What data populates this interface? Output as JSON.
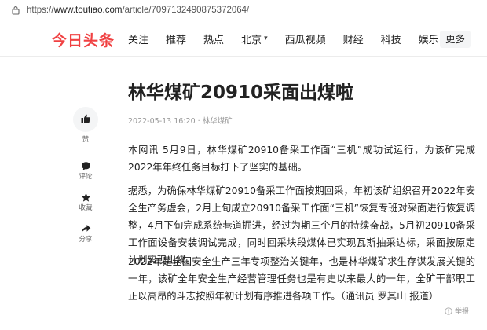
{
  "browser": {
    "url_prefix": "https://",
    "url_host": "www.toutiao.com",
    "url_path": "/article/7097132490875372064/"
  },
  "header": {
    "logo": "今日头条",
    "nav": [
      "关注",
      "推荐",
      "热点",
      "北京",
      "西瓜视频",
      "财经",
      "科技",
      "娱乐"
    ],
    "nav_dropdown_index": 3,
    "more": "更多"
  },
  "article": {
    "title": "林华煤矿20910采面出煤啦",
    "meta": "2022-05-13 16:20 · 林华煤矿",
    "paragraphs": [
      "本网讯 5月9日，林华煤矿20910备采工作面“三机”成功试运行，为该矿完成2022年年终任务目标打下了坚实的基础。",
      "据悉，为确保林华煤矿20910备采工作面按期回采，年初该矿组织召开2022年安全生产务虚会，2月上旬成立20910备采工作面“三机”恢复专班对采面进行恢复调整，4月下旬完成系统巷道掘进，经过为期三个月的持续奋战，5月初20910备采工作面设备安装调试完成，同时回采块段煤体已实现瓦斯抽采达标，采面按原定计划实现出煤。",
      "2022年是全国安全生产三年专项整治关键年，也是林华煤矿求生存谋发展关键的一年，该矿全年安全生产经营管理任务也是有史以来最大的一年，全矿干部职工正以高昂的斗志按照年初计划有序推进各项工作。（通讯员 罗其山 报道）"
    ]
  },
  "actions": {
    "like": "赞",
    "comment": "评论",
    "favorite": "收藏",
    "share": "分享"
  },
  "footer": {
    "report": "举报"
  },
  "colors": {
    "brand": "#f04142",
    "text": "#222222",
    "muted": "#999999"
  }
}
